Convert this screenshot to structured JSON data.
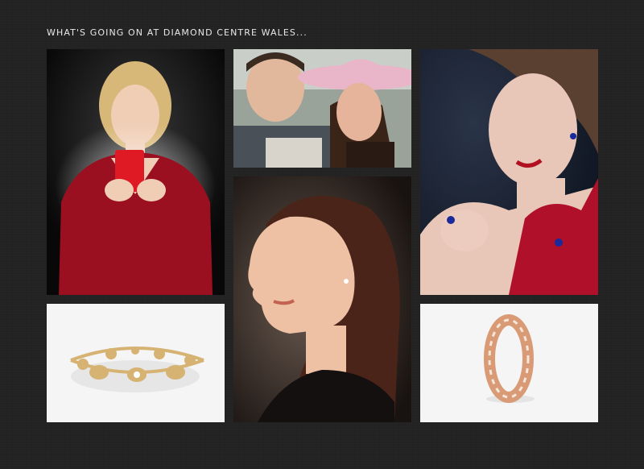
{
  "heading": "WHAT'S GOING ON AT DIAMOND CENTRE WALES...",
  "gallery": {
    "tiles": [
      {
        "subject": "woman in red dress opening glowing red ring box"
      },
      {
        "subject": "couple selfie, woman in pink hat"
      },
      {
        "subject": "woman with sapphire earrings, ring and pendant"
      },
      {
        "subject": "profile of woman wearing diamond stud earring"
      },
      {
        "subject": "gold bracelet with diamonds"
      },
      {
        "subject": "rose gold diamond eternity ring"
      }
    ]
  },
  "colors": {
    "background": "#222222",
    "heading_text": "#e8e8e8",
    "dress_red": "#9a1020",
    "gold": "#d6b373",
    "rose_gold": "#d99a76"
  }
}
